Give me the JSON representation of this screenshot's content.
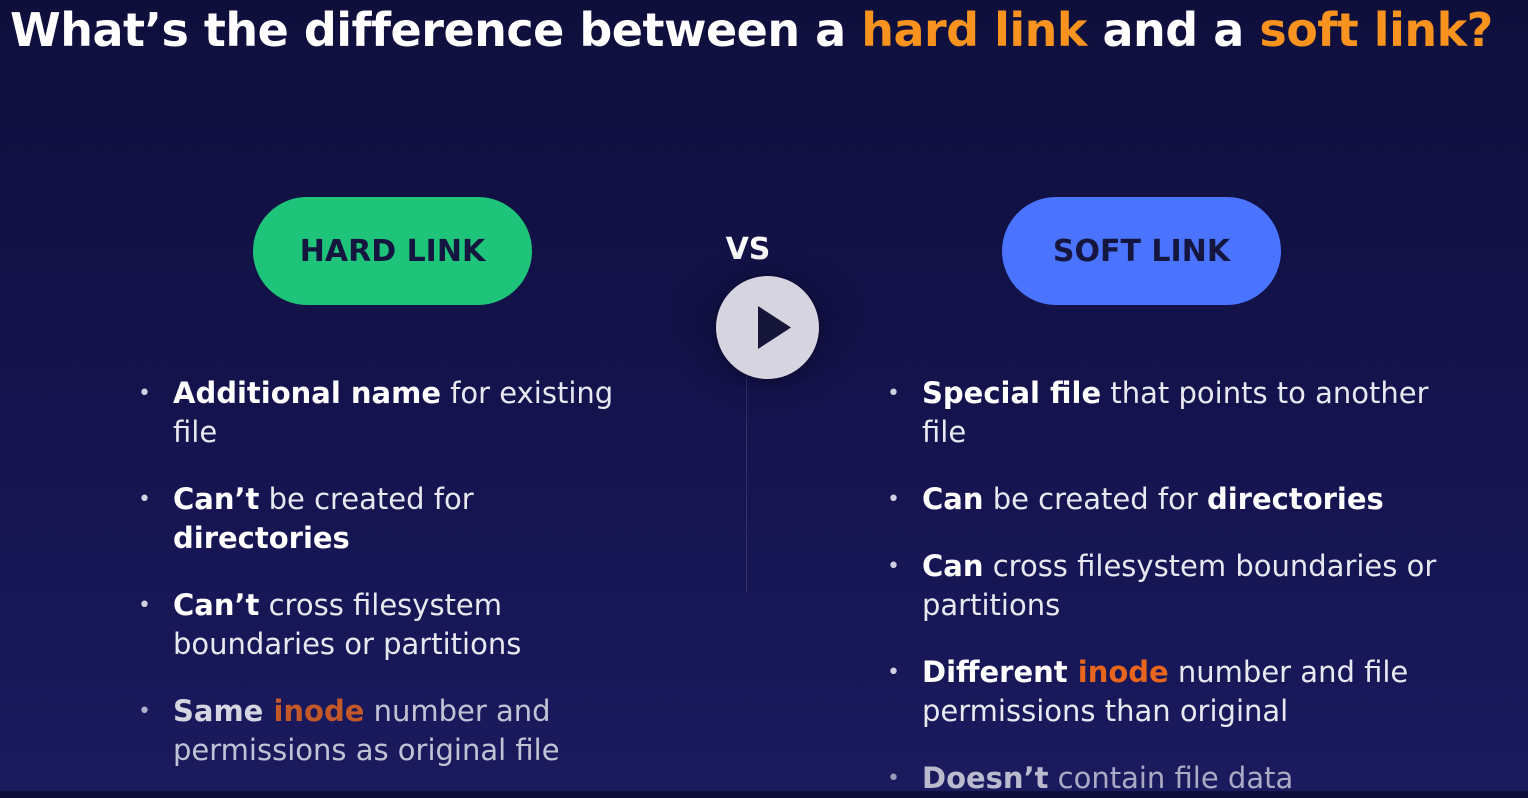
{
  "title": {
    "part1": "What’s the difference between a ",
    "highlight1": "hard link",
    "part2": " and a ",
    "highlight2": "soft link?"
  },
  "hard_label": "HARD LINK",
  "soft_label": "SOFT LINK",
  "vs_label": "VS",
  "colors": {
    "accent_orange": "#f7931e",
    "inode_orange": "#e8651e",
    "hard_green": "#1dc47a",
    "soft_blue": "#4a73ff",
    "background": "#14134d"
  },
  "icons": {
    "play": "play-icon"
  },
  "hard_points": [
    {
      "bold": "Additional name",
      "text": " for existing file"
    },
    {
      "bold": "Can’t",
      "text": " be created for ",
      "bold2": "directories"
    },
    {
      "bold": "Can’t",
      "text": " cross filesystem boundaries or partitions"
    },
    {
      "bold": "Same ",
      "highlight": "inode",
      "text": " number and permissions as original file"
    }
  ],
  "soft_points": [
    {
      "bold": "Special file",
      "text": " that points to another file"
    },
    {
      "bold": "Can",
      "text": " be created for ",
      "bold2": "directories"
    },
    {
      "bold": "Can",
      "text": " cross filesystem boundaries or partitions"
    },
    {
      "bold": "Different ",
      "highlight": "inode",
      "text": " number and file permissions than original"
    },
    {
      "bold": "Doesn’t",
      "text": " contain file data"
    }
  ]
}
